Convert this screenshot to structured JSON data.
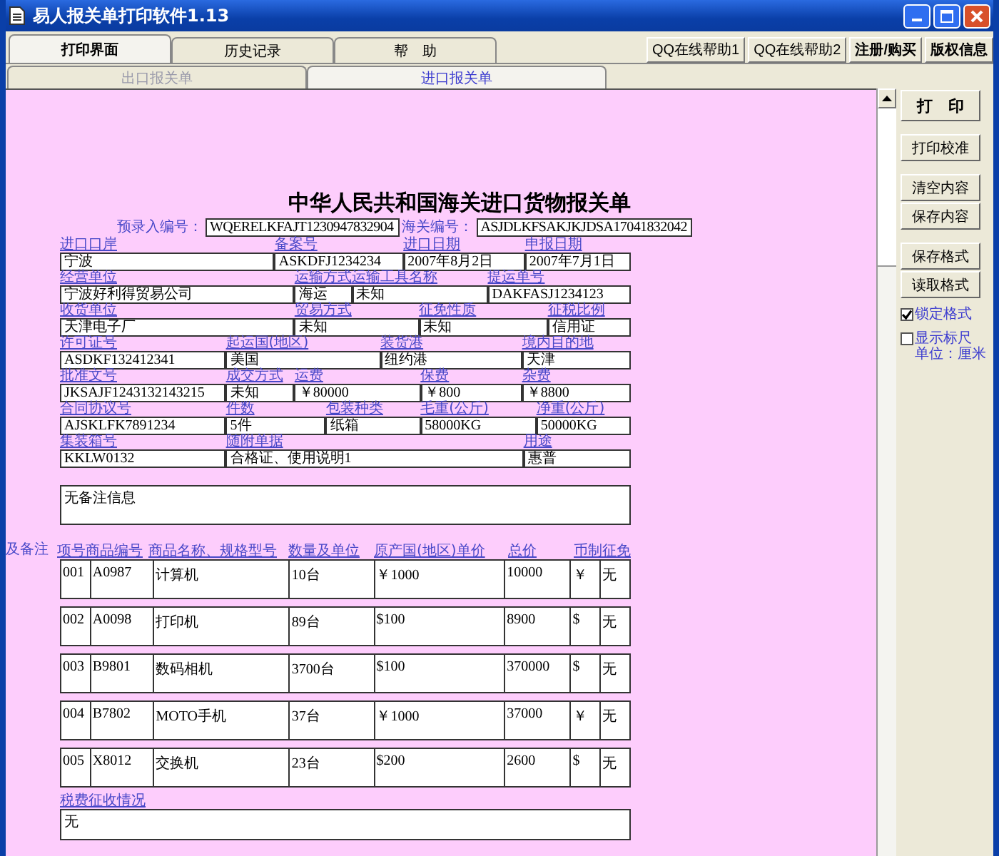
{
  "window": {
    "title": "易人报关单打印软件1.13"
  },
  "tabs": [
    {
      "label": "打印界面",
      "selected": true
    },
    {
      "label": "历史记录",
      "selected": false
    },
    {
      "label": "帮　助",
      "selected": false
    }
  ],
  "help_buttons": [
    "QQ在线帮助1",
    "QQ在线帮助2",
    "注册/购买",
    "版权信息"
  ],
  "sub_tabs": [
    {
      "label": "出口报关单",
      "selected": false
    },
    {
      "label": "进口报关单",
      "selected": true
    }
  ],
  "form": {
    "title": "中华人民共和国海关进口货物报关单",
    "entry_no": {
      "label": "预录入编号：",
      "value": "WQERELKFAJT1230947832904"
    },
    "customs_no": {
      "label": "海关编号：",
      "value": "ASJDLKFSAKJKJDSA17041832042"
    },
    "rows": [
      [
        {
          "label": "进口口岸",
          "value": "宁波"
        },
        {
          "label": "备案号",
          "value": "ASKDFJ1234234"
        },
        {
          "label": "进口日期",
          "value": "2007年8月2日"
        },
        {
          "label": "申报日期",
          "value": "2007年7月1日"
        }
      ],
      [
        {
          "label": "经营单位",
          "value": "宁波好利得贸易公司"
        },
        {
          "label": "运输方式",
          "value": "海运"
        },
        {
          "label": "运输工具名称",
          "value": "未知"
        },
        {
          "label": "提运单号",
          "value": "DAKFASJ1234123"
        }
      ],
      [
        {
          "label": "收货单位",
          "value": "天津电子厂"
        },
        {
          "label": "贸易方式",
          "value": "未知"
        },
        {
          "label": "征免性质",
          "value": "未知"
        },
        {
          "label": "征税比例",
          "value": "信用证"
        }
      ],
      [
        {
          "label": "许可证号",
          "value": "ASDKF132412341"
        },
        {
          "label": "起运国(地区)",
          "value": "美国"
        },
        {
          "label": "装货港",
          "value": "纽约港"
        },
        {
          "label": "境内目的地",
          "value": "天津"
        }
      ],
      [
        {
          "label": "批准文号",
          "value": "JKSAJF1243132143215"
        },
        {
          "label": "成交方式",
          "value": "未知"
        },
        {
          "label": "运费",
          "value": "￥80000"
        },
        {
          "label": "保费",
          "value": "￥800"
        },
        {
          "label": "杂费",
          "value": "￥8800"
        }
      ],
      [
        {
          "label": "合同协议号",
          "value": "AJSKLFK7891234"
        },
        {
          "label": "件数",
          "value": "5件"
        },
        {
          "label": "包装种类",
          "value": "纸箱"
        },
        {
          "label": "毛重(公斤)",
          "value": "58000KG"
        },
        {
          "label": "净重(公斤)",
          "value": "50000KG"
        }
      ],
      [
        {
          "label": "集装箱号",
          "value": "KKLW0132"
        },
        {
          "label": "随附单据",
          "value": "合格证、使用说明1"
        },
        {
          "label": "用途",
          "value": "惠普"
        }
      ]
    ],
    "remarks": "无备注信息",
    "marks_label": "及备注",
    "goods": {
      "columns": [
        "项号",
        "商品编号",
        "商品名称、规格型号",
        "数量及单位",
        "原产国(地区)单价",
        "总价",
        "币制",
        "征免"
      ],
      "rows": [
        [
          "001",
          "A0987",
          "计算机",
          "10台",
          "￥1000",
          "10000",
          "￥",
          "无"
        ],
        [
          "002",
          "A0098",
          "打印机",
          "89台",
          "$100",
          "8900",
          "$",
          "无"
        ],
        [
          "003",
          "B9801",
          "数码相机",
          "3700台",
          "$100",
          "370000",
          "$",
          "无"
        ],
        [
          "004",
          "B7802",
          "MOTO手机",
          "37台",
          "￥1000",
          "37000",
          "￥",
          "无"
        ],
        [
          "005",
          "X8012",
          "交换机",
          "23台",
          "$200",
          "2600",
          "$",
          "无"
        ]
      ]
    },
    "tax": {
      "label": "税费征收情况",
      "value": "无"
    }
  },
  "side_buttons": [
    "打　印",
    "打印校准",
    "清空内容",
    "保存内容",
    "保存格式",
    "读取格式"
  ],
  "options": [
    {
      "label": "锁定格式",
      "checked": true
    },
    {
      "label": "显示标尺",
      "checked": false
    }
  ],
  "ruler_unit": "单位：厘米"
}
